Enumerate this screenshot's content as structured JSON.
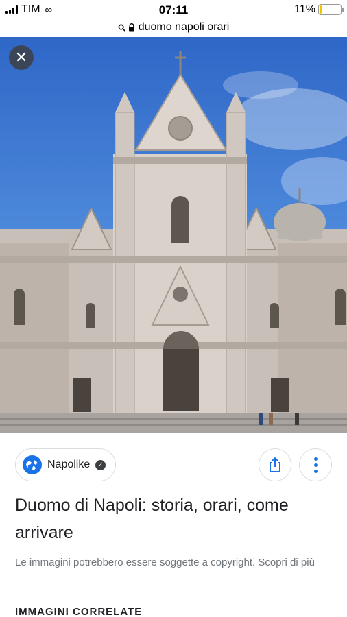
{
  "status_bar": {
    "carrier": "TIM",
    "time": "07:11",
    "battery_percent": "11%",
    "battery_level": 0.11,
    "battery_color": "#f2c500"
  },
  "url_bar": {
    "url_text": "duomo napoli orari",
    "icons": [
      "search-icon",
      "lock-icon"
    ]
  },
  "image_viewer": {
    "close_label": "✕",
    "image_subject": "Duomo di Napoli facade"
  },
  "details": {
    "source_name": "Napolike",
    "title": "Duomo di Napoli: storia, orari, come arrivare",
    "copyright_notice": "Le immagini potrebbero essere soggette a copyright. Scopri di più",
    "related_heading": "IMMAGINI CORRELATE"
  },
  "colors": {
    "accent": "#1a73e8",
    "muted_text": "#70757a",
    "sky": "#3a76cf"
  }
}
